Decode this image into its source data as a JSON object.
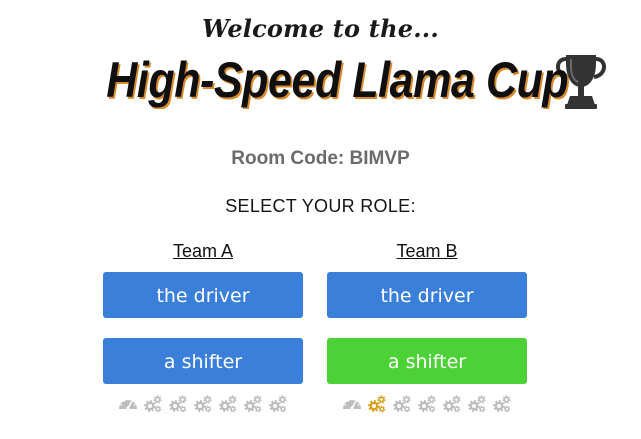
{
  "header": {
    "welcome": "Welcome to the...",
    "title": "High-Speed Llama Cup",
    "trophy_icon": "trophy-icon"
  },
  "room": {
    "prefix": "Room Code:",
    "code": "BIMVP"
  },
  "prompt": "SELECT YOUR ROLE:",
  "colors": {
    "button_blue": "#3a7fd9",
    "button_green": "#4cd137",
    "slot_empty": "#bdbdbd",
    "slot_filled": "#d9a11b"
  },
  "teams": [
    {
      "name": "Team A",
      "driver_label": "the driver",
      "shifter_label": "a shifter",
      "driver_color": "#3a7fd9",
      "shifter_color": "#3a7fd9",
      "slots": [
        {
          "icon": "speedometer-icon",
          "filled": false
        },
        {
          "icon": "gears-icon",
          "filled": false
        },
        {
          "icon": "gears-icon",
          "filled": false
        },
        {
          "icon": "gears-icon",
          "filled": false
        },
        {
          "icon": "gears-icon",
          "filled": false
        },
        {
          "icon": "gears-icon",
          "filled": false
        },
        {
          "icon": "gears-icon",
          "filled": false
        }
      ]
    },
    {
      "name": "Team B",
      "driver_label": "the driver",
      "shifter_label": "a shifter",
      "driver_color": "#3a7fd9",
      "shifter_color": "#4cd137",
      "slots": [
        {
          "icon": "speedometer-icon",
          "filled": false
        },
        {
          "icon": "gears-icon",
          "filled": true
        },
        {
          "icon": "gears-icon",
          "filled": false
        },
        {
          "icon": "gears-icon",
          "filled": false
        },
        {
          "icon": "gears-icon",
          "filled": false
        },
        {
          "icon": "gears-icon",
          "filled": false
        },
        {
          "icon": "gears-icon",
          "filled": false
        }
      ]
    }
  ]
}
